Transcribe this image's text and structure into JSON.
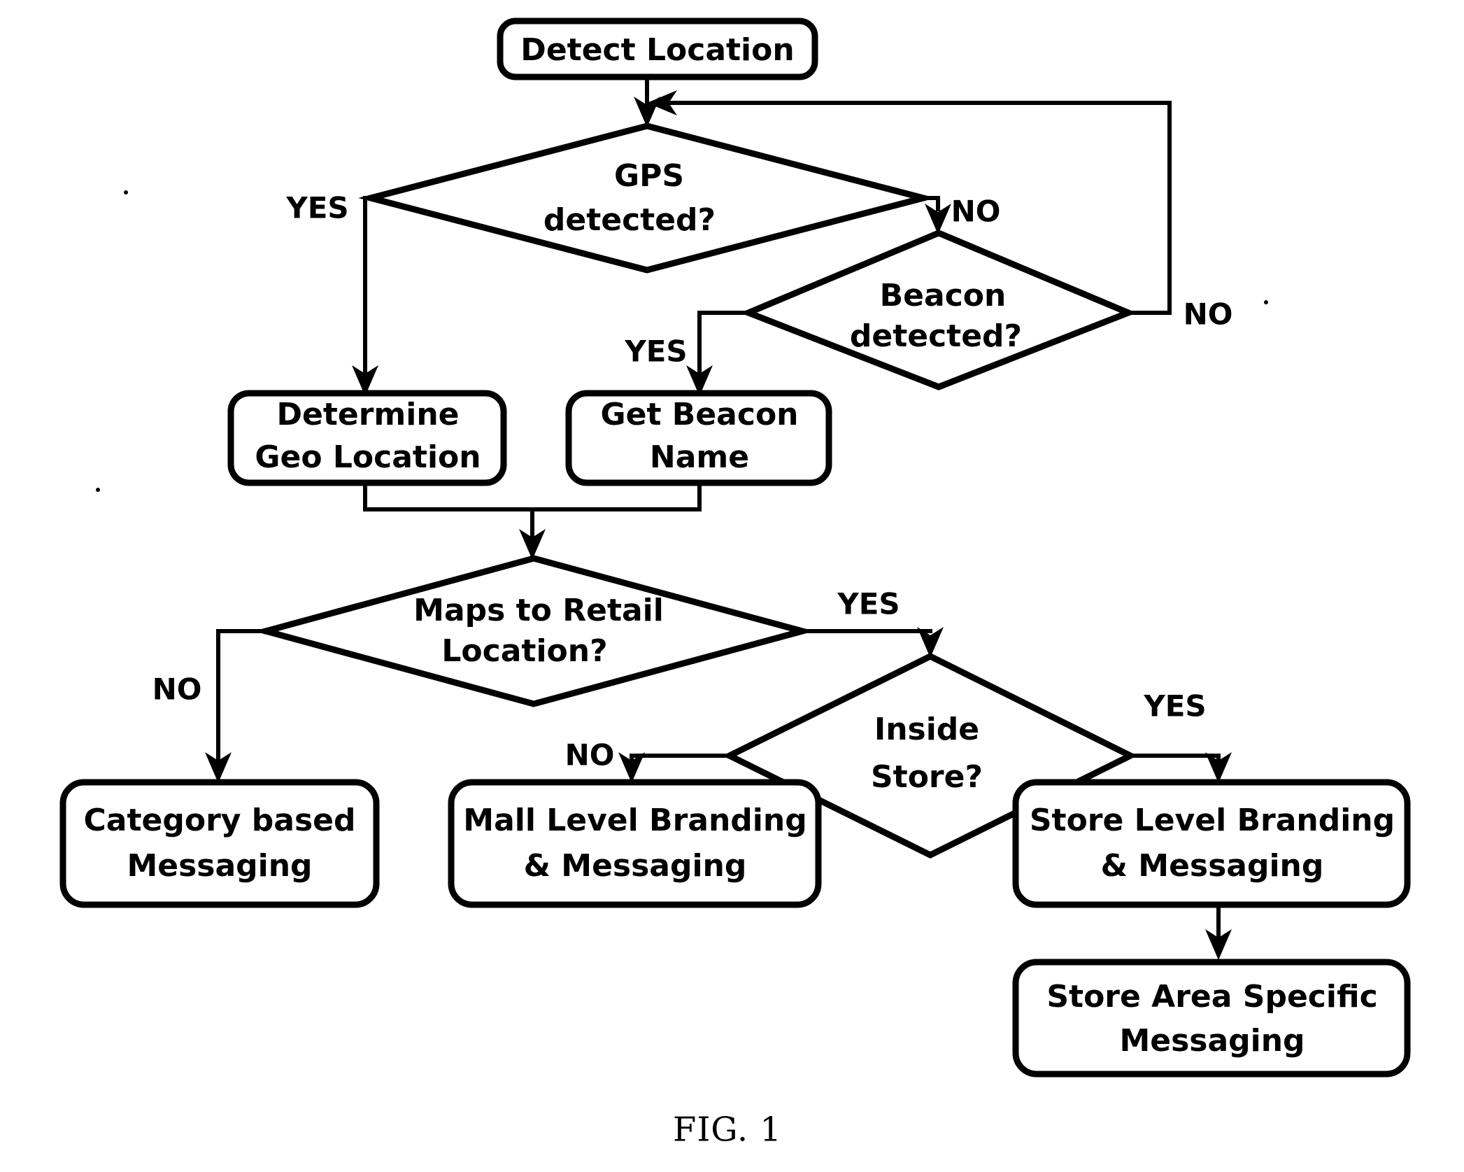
{
  "figure": {
    "caption": "FIG. 1",
    "type": "flowchart",
    "background_color": "#ffffff",
    "line_color": "#000000"
  },
  "nodes": [
    {
      "id": "detect-location",
      "shape": "rounded-rect",
      "label_line1": "Detect Location",
      "label_line2": ""
    },
    {
      "id": "gps-detected",
      "shape": "diamond",
      "label_line1": "GPS",
      "label_line2": "detected?"
    },
    {
      "id": "beacon-detected",
      "shape": "diamond",
      "label_line1": "Beacon",
      "label_line2": "detected?"
    },
    {
      "id": "determine-geo-location",
      "shape": "rounded-rect",
      "label_line1": "Determine",
      "label_line2": "Geo Location"
    },
    {
      "id": "get-beacon-name",
      "shape": "rounded-rect",
      "label_line1": "Get Beacon",
      "label_line2": "Name"
    },
    {
      "id": "maps-to-retail",
      "shape": "diamond",
      "label_line1": "Maps to Retail",
      "label_line2": "Location?"
    },
    {
      "id": "inside-store",
      "shape": "diamond",
      "label_line1": "Inside",
      "label_line2": "Store?"
    },
    {
      "id": "category-based",
      "shape": "rounded-rect",
      "label_line1": "Category based",
      "label_line2": "Messaging"
    },
    {
      "id": "mall-level",
      "shape": "rounded-rect",
      "label_line1": "Mall Level Branding",
      "label_line2": "& Messaging"
    },
    {
      "id": "store-level",
      "shape": "rounded-rect",
      "label_line1": "Store Level Branding",
      "label_line2": "& Messaging"
    },
    {
      "id": "store-area-specific",
      "shape": "rounded-rect",
      "label_line1": "Store Area Specific",
      "label_line2": "Messaging"
    }
  ],
  "edges": [
    {
      "id": "detect-to-gps",
      "from": "detect-location",
      "to": "gps-detected",
      "label": ""
    },
    {
      "id": "gps-yes",
      "from": "gps-detected",
      "to": "determine-geo-location",
      "label": "YES"
    },
    {
      "id": "gps-no",
      "from": "gps-detected",
      "to": "beacon-detected",
      "label": "NO"
    },
    {
      "id": "beacon-yes",
      "from": "beacon-detected",
      "to": "get-beacon-name",
      "label": "YES"
    },
    {
      "id": "beacon-no",
      "from": "beacon-detected",
      "to": "detect-location",
      "label": "NO"
    },
    {
      "id": "geo-to-maps",
      "from": "determine-geo-location",
      "to": "maps-to-retail",
      "label": ""
    },
    {
      "id": "beaconname-to-maps",
      "from": "get-beacon-name",
      "to": "maps-to-retail",
      "label": ""
    },
    {
      "id": "maps-no",
      "from": "maps-to-retail",
      "to": "category-based",
      "label": "NO"
    },
    {
      "id": "maps-yes",
      "from": "maps-to-retail",
      "to": "inside-store",
      "label": "YES"
    },
    {
      "id": "inside-no",
      "from": "inside-store",
      "to": "mall-level",
      "label": "NO"
    },
    {
      "id": "inside-yes",
      "from": "inside-store",
      "to": "store-level",
      "label": "YES"
    },
    {
      "id": "storelevel-to-storearea",
      "from": "store-level",
      "to": "store-area-specific",
      "label": ""
    }
  ],
  "edge_labels": {
    "gps_yes": "YES",
    "gps_no": "NO",
    "beacon_yes": "YES",
    "beacon_no": "NO",
    "maps_no": "NO",
    "maps_yes": "YES",
    "inside_no": "NO",
    "inside_yes": "YES"
  },
  "node_labels": {
    "detect_location": "Detect Location",
    "gps_l1": "GPS",
    "gps_l2": "detected?",
    "beacon_l1": "Beacon",
    "beacon_l2": "detected?",
    "determine_l1": "Determine",
    "determine_l2": "Geo Location",
    "beaconname_l1": "Get Beacon",
    "beaconname_l2": "Name",
    "maps_l1": "Maps to Retail",
    "maps_l2": "Location?",
    "inside_l1": "Inside",
    "inside_l2": "Store?",
    "category_l1": "Category based",
    "category_l2": "Messaging",
    "mall_l1": "Mall Level Branding",
    "mall_l2": "& Messaging",
    "storelevel_l1": "Store Level Branding",
    "storelevel_l2": "& Messaging",
    "storearea_l1": "Store Area Specific",
    "storearea_l2": "Messaging"
  }
}
